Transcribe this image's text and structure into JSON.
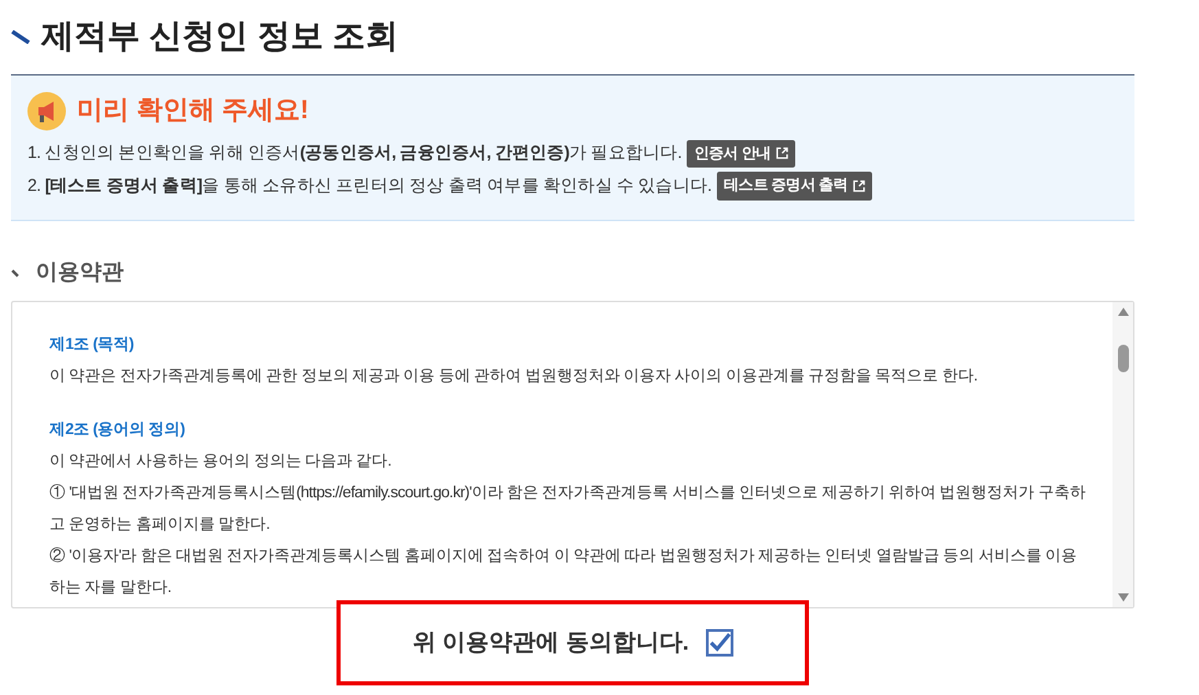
{
  "page_title": "제적부 신청인 정보 조회",
  "notice": {
    "title": "미리 확인해 주세요!",
    "items": [
      {
        "text": "1. 신청인의 본인확인을 위해 인증서**(공동인증서, 금융인증서, 간편인증)**가 필요합니다.",
        "button": "인증서 안내"
      },
      {
        "text": "2. **[테스트 증명서 출력]**을 통해 소유하신 프린터의 정상 출력 여부를 확인하실 수 있습니다.",
        "button": "테스트 증명서 출력"
      }
    ]
  },
  "terms": {
    "heading": "이용약관",
    "articles": [
      {
        "title": "제1조 (목적)",
        "paragraphs": [
          "이 약관은 전자가족관계등록에 관한 정보의 제공과 이용 등에 관하여 법원행정처와 이용자 사이의 이용관계를 규정함을 목적으로 한다."
        ]
      },
      {
        "title": "제2조 (용어의 정의)",
        "paragraphs": [
          "이 약관에서 사용하는 용어의 정의는 다음과 같다.",
          "① '대법원 전자가족관계등록시스템(https://efamily.scourt.go.kr)'이라 함은 전자가족관계등록 서비스를 인터넷으로 제공하기 위하여 법원행정처가 구축하고 운영하는 홈페이지를 말한다.",
          "② '이용자'라 함은 대법원 전자가족관계등록시스템 홈페이지에 접속하여 이 약관에 따라 법원행정처가 제공하는 인터넷 열람발급 등의 서비스를 이용하는 자를 말한다."
        ]
      }
    ]
  },
  "agree": {
    "label": "위 이용약관에 동의합니다.",
    "checked": true
  }
}
